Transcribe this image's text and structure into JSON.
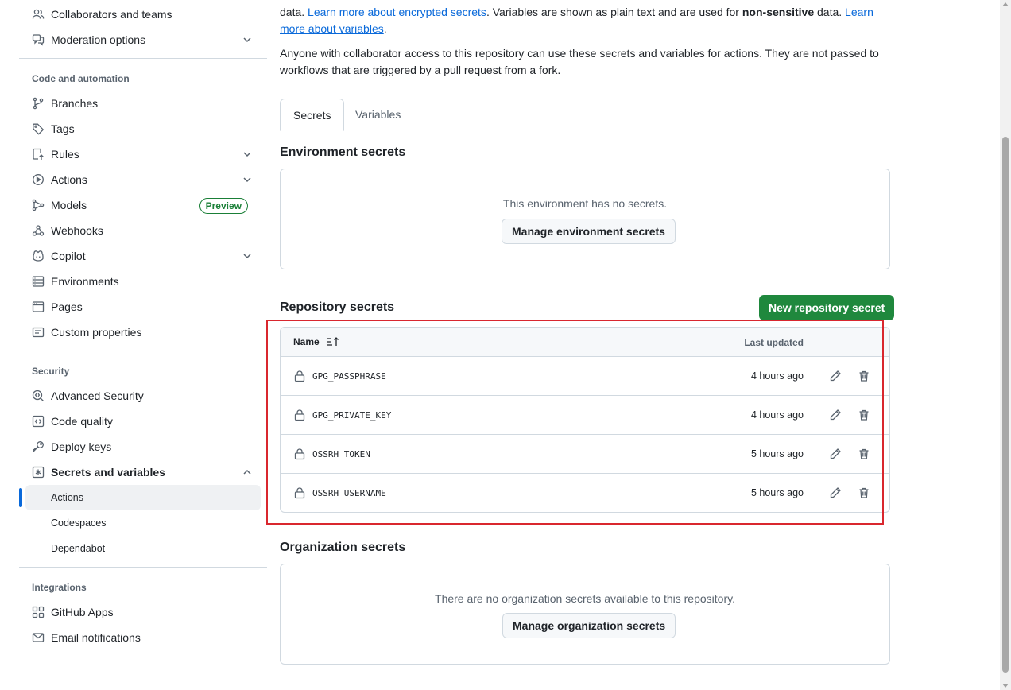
{
  "sidebar": {
    "top_items": [
      {
        "label": "Collaborators and teams",
        "icon": "people-icon"
      },
      {
        "label": "Moderation options",
        "icon": "comment-discussion-icon",
        "expandable": true
      }
    ],
    "code_automation": {
      "title": "Code and automation",
      "items": [
        {
          "label": "Branches",
          "icon": "git-branch-icon"
        },
        {
          "label": "Tags",
          "icon": "tag-icon"
        },
        {
          "label": "Rules",
          "icon": "repo-push-icon",
          "expandable": true
        },
        {
          "label": "Actions",
          "icon": "play-icon",
          "expandable": true
        },
        {
          "label": "Models",
          "icon": "ai-model-icon",
          "badge": "Preview"
        },
        {
          "label": "Webhooks",
          "icon": "webhook-icon"
        },
        {
          "label": "Copilot",
          "icon": "copilot-icon",
          "expandable": true
        },
        {
          "label": "Environments",
          "icon": "server-icon"
        },
        {
          "label": "Pages",
          "icon": "browser-icon"
        },
        {
          "label": "Custom properties",
          "icon": "note-icon"
        }
      ]
    },
    "security": {
      "title": "Security",
      "items": [
        {
          "label": "Advanced Security",
          "icon": "codescan-icon"
        },
        {
          "label": "Code quality",
          "icon": "code-square-icon"
        },
        {
          "label": "Deploy keys",
          "icon": "key-icon"
        },
        {
          "label": "Secrets and variables",
          "icon": "key-asterisk-icon",
          "expanded": true
        }
      ],
      "sub_items": [
        {
          "label": "Actions",
          "active": true
        },
        {
          "label": "Codespaces"
        },
        {
          "label": "Dependabot"
        }
      ]
    },
    "integrations": {
      "title": "Integrations",
      "items": [
        {
          "label": "GitHub Apps",
          "icon": "apps-icon"
        },
        {
          "label": "Email notifications",
          "icon": "mail-icon"
        }
      ]
    }
  },
  "main": {
    "intro": {
      "prefix": "data. ",
      "link1": "Learn more about encrypted secrets",
      "middle": ". Variables are shown as plain text and are used for ",
      "bold": "non-sensitive",
      "after_bold": " data. ",
      "link2": "Learn more about variables",
      "suffix": "."
    },
    "access_note": "Anyone with collaborator access to this repository can use these secrets and variables for actions. They are not passed to workflows that are triggered by a pull request from a fork.",
    "tabs": [
      "Secrets",
      "Variables"
    ],
    "environment": {
      "title": "Environment secrets",
      "empty": "This environment has no secrets.",
      "button": "Manage environment secrets"
    },
    "repository": {
      "title": "Repository secrets",
      "new_button": "New repository secret",
      "col_name": "Name",
      "col_updated": "Last updated",
      "rows": [
        {
          "name": "GPG_PASSPHRASE",
          "updated": "4 hours ago"
        },
        {
          "name": "GPG_PRIVATE_KEY",
          "updated": "4 hours ago"
        },
        {
          "name": "OSSRH_TOKEN",
          "updated": "5 hours ago"
        },
        {
          "name": "OSSRH_USERNAME",
          "updated": "5 hours ago"
        }
      ]
    },
    "organization": {
      "title": "Organization secrets",
      "empty": "There are no organization secrets available to this repository.",
      "button": "Manage organization secrets"
    }
  },
  "colors": {
    "accent": "#0969da",
    "primary_button": "#1f883d",
    "highlight_outline": "#d9272e",
    "preview_badge": "#1a7f37"
  }
}
